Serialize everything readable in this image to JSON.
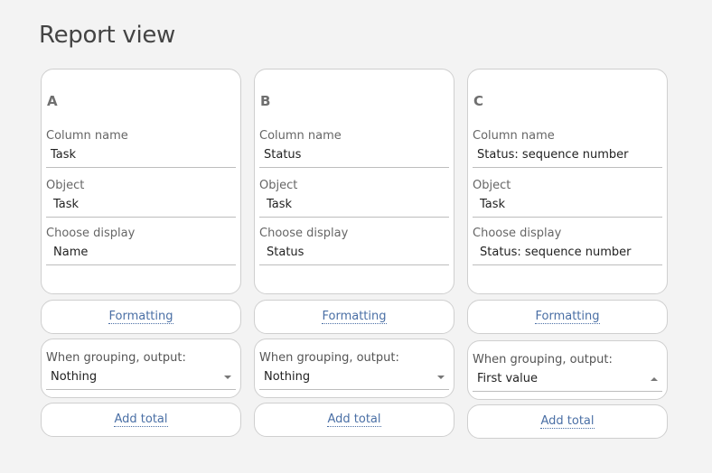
{
  "page": {
    "title": "Report view"
  },
  "columns": [
    {
      "letter": "A",
      "column_name_label": "Column name",
      "column_name": "Task",
      "object_label": "Object",
      "object": "Task",
      "display_label": "Choose display",
      "display": "Name",
      "formatting": "Formatting",
      "grouping_label": "When grouping, output:",
      "grouping_value": "Nothing",
      "grouping_open": false,
      "add_total": "Add total"
    },
    {
      "letter": "B",
      "column_name_label": "Column name",
      "column_name": "Status",
      "object_label": "Object",
      "object": "Task",
      "display_label": "Choose display",
      "display": "Status",
      "formatting": "Formatting",
      "grouping_label": "When grouping, output:",
      "grouping_value": "Nothing",
      "grouping_open": false,
      "add_total": "Add total"
    },
    {
      "letter": "C",
      "column_name_label": "Column name",
      "column_name": "Status: sequence number",
      "object_label": "Object",
      "object": "Task",
      "display_label": "Choose display",
      "display": "Status: sequence number",
      "formatting": "Formatting",
      "grouping_label": "When grouping, output:",
      "grouping_value": "First value",
      "grouping_open": true,
      "add_total": "Add total"
    }
  ],
  "icons": {
    "dropdown": "caret-down-icon",
    "dropdown_open": "caret-up-icon"
  }
}
